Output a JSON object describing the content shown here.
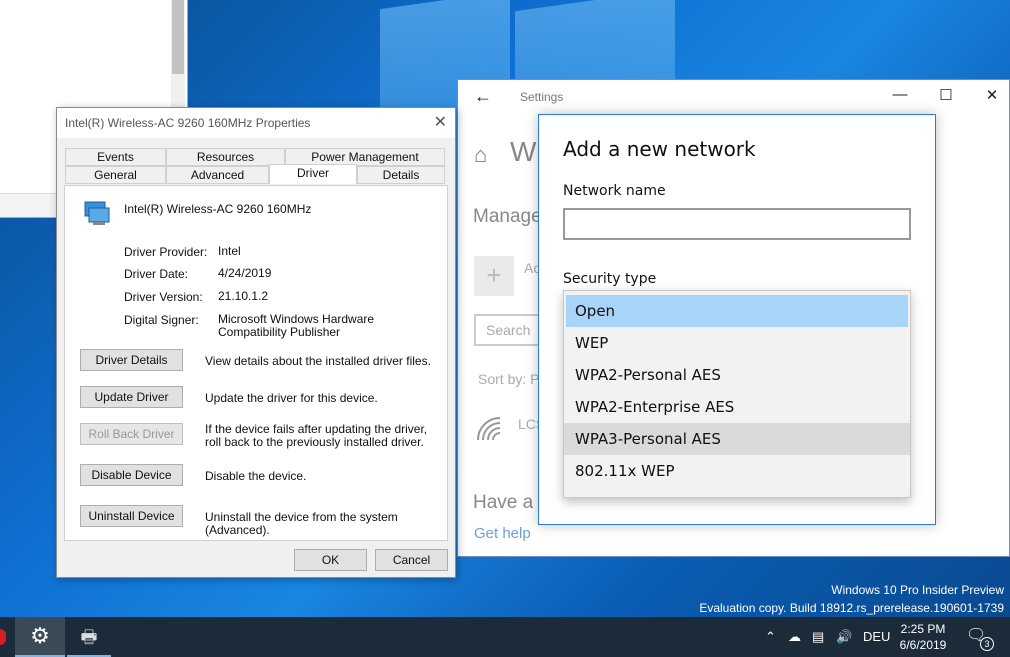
{
  "properties_dialog": {
    "title": "Intel(R) Wireless-AC 9260 160MHz Properties",
    "tabs_row1": [
      "Events",
      "Resources",
      "Power Management"
    ],
    "tabs_row2": [
      "General",
      "Advanced",
      "Driver",
      "Details"
    ],
    "active_tab": "Driver",
    "device_name": "Intel(R) Wireless-AC 9260 160MHz",
    "fields": [
      {
        "key": "Driver Provider:",
        "value": "Intel"
      },
      {
        "key": "Driver Date:",
        "value": "4/24/2019"
      },
      {
        "key": "Driver Version:",
        "value": "21.10.1.2"
      },
      {
        "key": "Digital Signer:",
        "value": "Microsoft Windows Hardware Compatibility Publisher"
      }
    ],
    "actions": [
      {
        "label": "Driver Details",
        "desc": "View details about the installed driver files.",
        "enabled": true
      },
      {
        "label": "Update Driver",
        "desc": "Update the driver for this device.",
        "enabled": true
      },
      {
        "label": "Roll Back Driver",
        "desc": "If the device fails after updating the driver, roll back to the previously installed driver.",
        "enabled": false
      },
      {
        "label": "Disable Device",
        "desc": "Disable the device.",
        "enabled": true
      },
      {
        "label": "Uninstall Device",
        "desc": "Uninstall the device from the system (Advanced).",
        "enabled": true
      }
    ],
    "ok_label": "OK",
    "cancel_label": "Cancel"
  },
  "settings_window": {
    "title": "Settings",
    "page_title_partial": "W",
    "section_manage_partial": "Manage",
    "add_partial": "Ac",
    "search_placeholder_partial": "Search",
    "sort_by_partial": "Sort by: P",
    "network_partial": "LCS",
    "have_a_partial": "Have a",
    "get_help": "Get help"
  },
  "add_network_dialog": {
    "heading": "Add a new network",
    "network_name_label": "Network name",
    "network_name_value": "",
    "security_type_label": "Security type",
    "security_options": [
      "Open",
      "WEP",
      "WPA2-Personal AES",
      "WPA2-Enterprise AES",
      "WPA3-Personal AES",
      "802.11x WEP"
    ],
    "selected_option": "Open",
    "hovered_option": "WPA3-Personal AES"
  },
  "watermark": {
    "line1": "Windows 10 Pro Insider Preview",
    "line2": "Evaluation copy. Build 18912.rs_prerelease.190601-1739"
  },
  "taskbar": {
    "language": "DEU",
    "time": "2:25 PM",
    "date": "6/6/2019",
    "notification_count": "3"
  },
  "icons": {
    "back": "back-arrow-icon",
    "home": "home-icon",
    "settings_app": "gear-icon",
    "wifi": "wifi-icon",
    "network_adapter": "network-adapter-icon"
  }
}
